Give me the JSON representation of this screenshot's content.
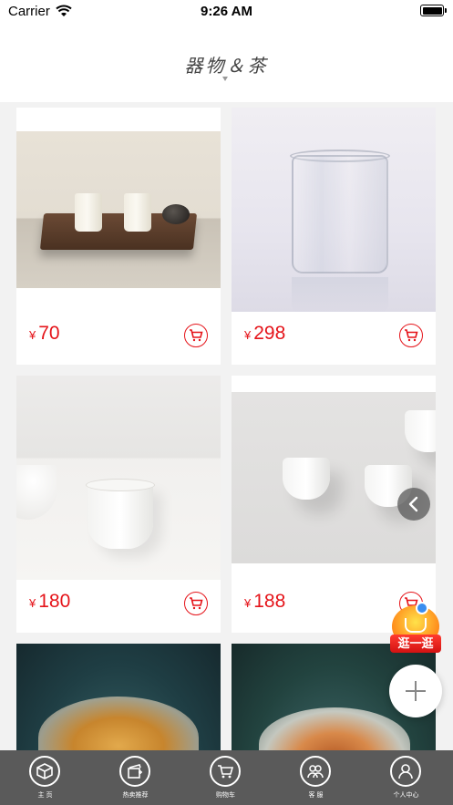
{
  "status_bar": {
    "carrier": "Carrier",
    "time": "9:26 AM"
  },
  "header": {
    "title": "器物＆茶"
  },
  "products": [
    {
      "currency": "¥",
      "price": "70"
    },
    {
      "currency": "¥",
      "price": "298"
    },
    {
      "currency": "¥",
      "price": "180"
    },
    {
      "currency": "¥",
      "price": "188"
    }
  ],
  "floating": {
    "shop_label": "逛一逛"
  },
  "tabbar": {
    "items": [
      {
        "label": "主 页",
        "icon": "box-icon"
      },
      {
        "label": "热卖推荐",
        "icon": "hot-sale-icon"
      },
      {
        "label": "购物车",
        "icon": "cart-icon"
      },
      {
        "label": "客 服",
        "icon": "service-icon"
      },
      {
        "label": "个人中心",
        "icon": "person-icon"
      }
    ]
  },
  "colors": {
    "accent": "#e5141a",
    "tabbar_bg": "#5a5a5a"
  }
}
